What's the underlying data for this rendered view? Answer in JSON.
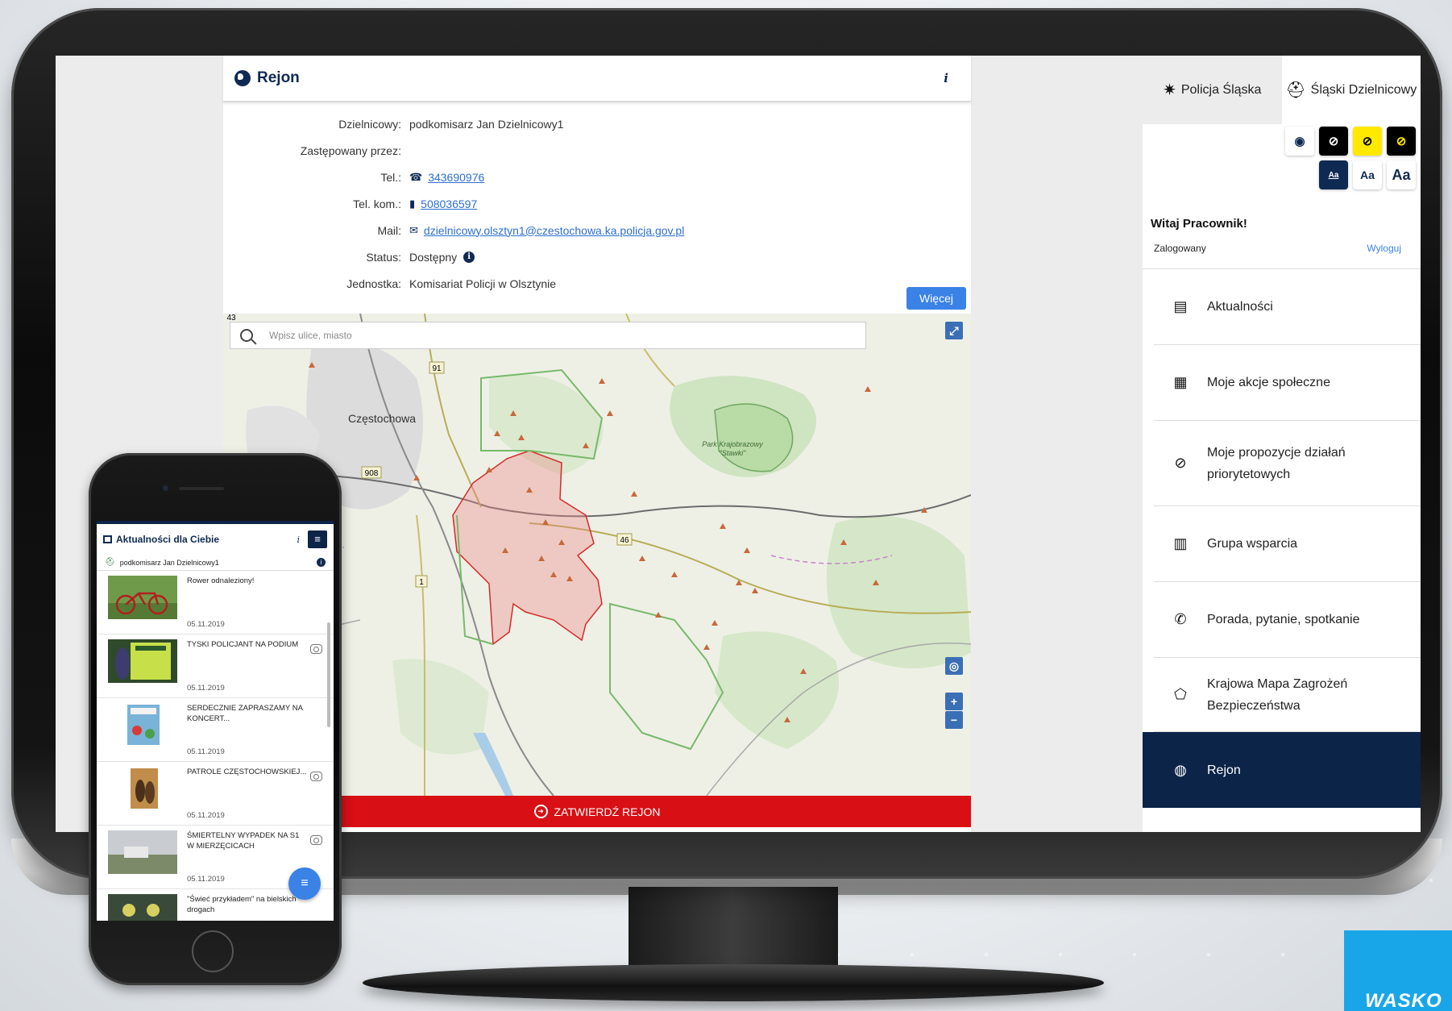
{
  "card": {
    "title": "Rejon",
    "info_label": "i",
    "details": [
      {
        "label": "Dzielnicowy:",
        "value": "podkomisarz Jan Dzielnicowy1"
      },
      {
        "label": "Zastępowany przez:",
        "value": ""
      },
      {
        "label": "Tel.:",
        "value": "343690976"
      },
      {
        "label": "Tel. kom.:",
        "value": "508036597"
      },
      {
        "label": "Mail:",
        "value": "dzielnicowy.olsztyn1@czestochowa.ka.policja.gov.pl"
      },
      {
        "label": "Status:",
        "value": "Dostępny"
      },
      {
        "label": "Jednostka:",
        "value": "Komisariat Policji w Olsztynie"
      }
    ],
    "more_button": "Więcej",
    "map": {
      "search_placeholder": "Wpisz ulice, miasto",
      "city_label": "Częstochowa",
      "park_label_1": "Park Krajobrazowy",
      "park_label_2": "\"Stawki\"",
      "road_labels": [
        "91",
        "908",
        "46",
        "1",
        "43"
      ],
      "zoom_in": "+",
      "zoom_out": "−"
    },
    "confirm_button": "ZATWIERDŹ REJON"
  },
  "sidebar": {
    "tabs": [
      {
        "label": "Policja Śląska"
      },
      {
        "label": "Śląski Dzielnicowy"
      }
    ],
    "font_sizes": [
      "Aa",
      "Aa",
      "Aa"
    ],
    "greeting": "Witaj Pracownik!",
    "logged_status": "Zalogowany",
    "logout": "Wyloguj",
    "menu": [
      {
        "label": "Aktualności",
        "icon": "newspaper-icon"
      },
      {
        "label": "Moje akcje społeczne",
        "icon": "clipboard-icon"
      },
      {
        "label": "Moje propozycje działań priorytetowych",
        "icon": "compass-icon"
      },
      {
        "label": "Grupa wsparcia",
        "icon": "building-icon"
      },
      {
        "label": "Porada, pytanie, spotkanie",
        "icon": "phone-list-icon"
      },
      {
        "label": "Krajowa Mapa Zagrożeń Bezpieczeństwa",
        "icon": "poland-map-icon"
      },
      {
        "label": "Rejon",
        "icon": "globe-icon",
        "active": true
      }
    ]
  },
  "phone": {
    "title": "Aktualności dla Ciebie",
    "info_label": "i",
    "user": "podkomisarz Jan Dzielnicowy1",
    "news": [
      {
        "title": "Rower odnaleziony!",
        "date": "05.11.2019",
        "photo": false
      },
      {
        "title": "TYSKI POLICJANT NA PODIUM",
        "date": "05.11.2019",
        "photo": true
      },
      {
        "title": "SERDECZNIE ZAPRASZAMY NA KONCERT...",
        "date": "05.11.2019",
        "photo": false
      },
      {
        "title": "PATROLE CZĘSTOCHOWSKIEJ...",
        "date": "05.11.2019",
        "photo": true
      },
      {
        "title": "ŚMIERTELNY WYPADEK NA S1 W MIERZĘCICACH",
        "date": "05.11.2019",
        "photo": true
      },
      {
        "title": "\"Świeć przykładem\" na bielskich drogach",
        "date": "",
        "photo": false
      }
    ]
  },
  "brand": {
    "label": "WASKO"
  },
  "colors": {
    "navy": "#0c2448",
    "red": "#d80f14",
    "blue": "#3a82e6",
    "brand": "#19a6e8"
  }
}
